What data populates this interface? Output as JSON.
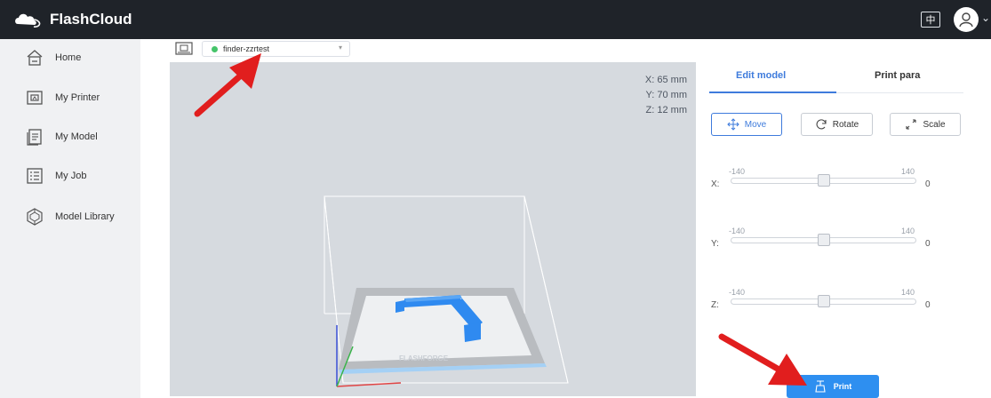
{
  "app": {
    "title": "FlashCloud",
    "lang_label": "中"
  },
  "sidebar": {
    "items": [
      {
        "label": "Home",
        "icon": "home-icon"
      },
      {
        "label": "My Printer",
        "icon": "printer-icon"
      },
      {
        "label": "My Model",
        "icon": "model-icon"
      },
      {
        "label": "My Job",
        "icon": "job-icon"
      },
      {
        "label": "Model Library",
        "icon": "library-icon"
      }
    ]
  },
  "printer_select": {
    "value": "finder-zzrtest",
    "status": "online",
    "status_color": "#45c46a"
  },
  "viewport": {
    "coords": {
      "x": "X:  65 mm",
      "y": "Y:  70 mm",
      "z": "Z:  12 mm"
    },
    "bed_watermark": "FLASHFORGE"
  },
  "panel": {
    "tabs": {
      "edit": "Edit model",
      "print": "Print para"
    },
    "tools": {
      "move": "Move",
      "rotate": "Rotate",
      "scale": "Scale"
    },
    "sliders": {
      "x": {
        "axis": "X:",
        "min": "-140",
        "max": "140",
        "value": "0",
        "position": 0.5
      },
      "y": {
        "axis": "Y:",
        "min": "-140",
        "max": "140",
        "value": "0",
        "position": 0.5
      },
      "z": {
        "axis": "Z:",
        "min": "-140",
        "max": "140",
        "value": "0",
        "position": 0.5
      }
    },
    "print_label": "Print"
  },
  "colors": {
    "accent": "#3e7bdc",
    "print_button": "#2e8ff0",
    "model": "#2f8af0",
    "topbar": "#1f2329"
  }
}
